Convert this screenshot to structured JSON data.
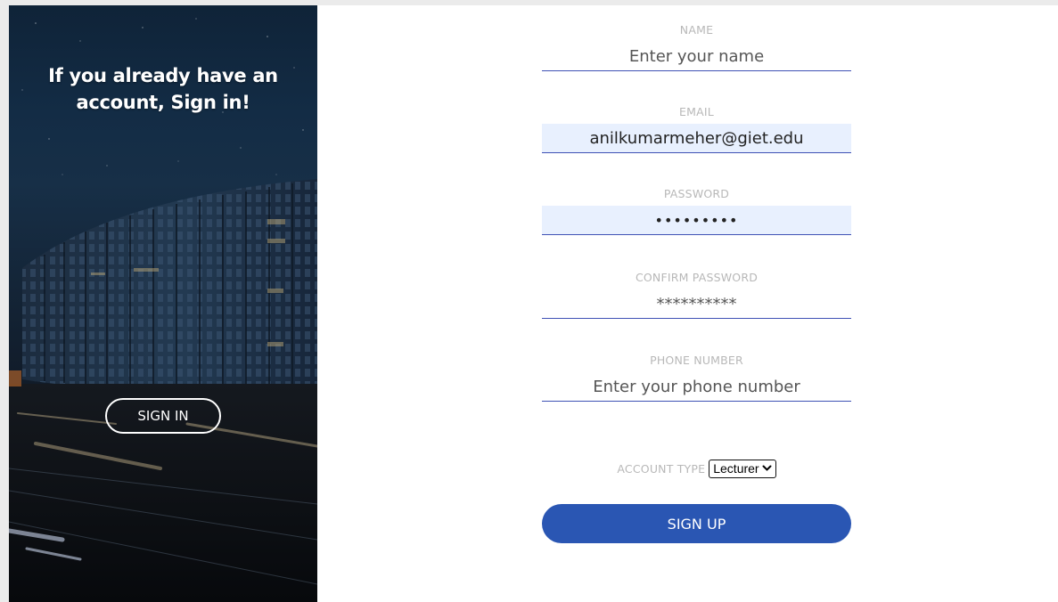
{
  "hero": {
    "heading": "If you already have an account, Sign in!",
    "sign_in_label": "SIGN IN"
  },
  "form": {
    "name": {
      "label": "NAME",
      "value": "",
      "placeholder": "Enter your name"
    },
    "email": {
      "label": "EMAIL",
      "value": "anilkumarmeher@giet.edu",
      "placeholder": ""
    },
    "password": {
      "label": "PASSWORD",
      "value": "•••••••••"
    },
    "confirm_password": {
      "label": "CONFIRM PASSWORD",
      "value": "",
      "placeholder": "**********"
    },
    "phone": {
      "label": "PHONE NUMBER",
      "value": "",
      "placeholder": "Enter your phone number"
    },
    "account_type": {
      "label": "ACCOUNT TYPE",
      "selected": "Lecturer"
    },
    "sign_up_label": "SIGN UP"
  },
  "colors": {
    "accent": "#2a56b3",
    "underline": "#3f51b5",
    "label": "#b8b8b8",
    "autofill": "#e8f0fe"
  },
  "icons": {
    "select_arrow": "chevron-down-icon"
  }
}
